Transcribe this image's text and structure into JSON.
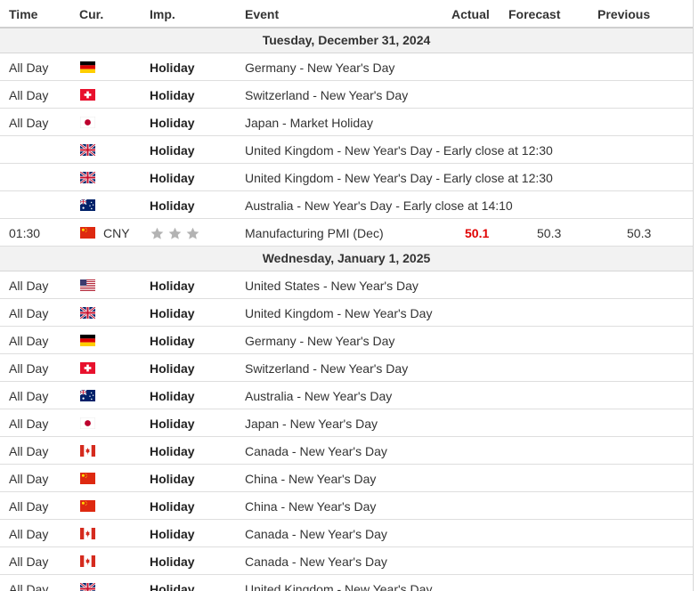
{
  "header": {
    "time": "Time",
    "currency": "Cur.",
    "importance": "Imp.",
    "event": "Event",
    "actual": "Actual",
    "forecast": "Forecast",
    "previous": "Previous"
  },
  "days": [
    {
      "date": "Tuesday, December 31, 2024",
      "rows": [
        {
          "time": "All Day",
          "flag": "de",
          "currency": "",
          "importance": "Holiday",
          "event": "Germany - New Year's Day",
          "actual": "",
          "forecast": "",
          "previous": ""
        },
        {
          "time": "All Day",
          "flag": "ch",
          "currency": "",
          "importance": "Holiday",
          "event": "Switzerland - New Year's Day",
          "actual": "",
          "forecast": "",
          "previous": ""
        },
        {
          "time": "All Day",
          "flag": "jp",
          "currency": "",
          "importance": "Holiday",
          "event": "Japan - Market Holiday",
          "actual": "",
          "forecast": "",
          "previous": ""
        },
        {
          "time": "",
          "flag": "gb",
          "currency": "",
          "importance": "Holiday",
          "event": "United Kingdom - New Year's Day - Early close at 12:30",
          "actual": "",
          "forecast": "",
          "previous": ""
        },
        {
          "time": "",
          "flag": "gb",
          "currency": "",
          "importance": "Holiday",
          "event": "United Kingdom - New Year's Day - Early close at 12:30",
          "actual": "",
          "forecast": "",
          "previous": ""
        },
        {
          "time": "",
          "flag": "au",
          "currency": "",
          "importance": "Holiday",
          "event": "Australia - New Year's Day - Early close at 14:10",
          "actual": "",
          "forecast": "",
          "previous": ""
        },
        {
          "time": "01:30",
          "flag": "cn",
          "currency": "CNY",
          "importance": "",
          "stars": 3,
          "event": "Manufacturing PMI (Dec)",
          "actual": "50.1",
          "forecast": "50.3",
          "previous": "50.3"
        }
      ]
    },
    {
      "date": "Wednesday, January 1, 2025",
      "rows": [
        {
          "time": "All Day",
          "flag": "us",
          "currency": "",
          "importance": "Holiday",
          "event": "United States - New Year's Day",
          "actual": "",
          "forecast": "",
          "previous": ""
        },
        {
          "time": "All Day",
          "flag": "gb",
          "currency": "",
          "importance": "Holiday",
          "event": "United Kingdom - New Year's Day",
          "actual": "",
          "forecast": "",
          "previous": ""
        },
        {
          "time": "All Day",
          "flag": "de",
          "currency": "",
          "importance": "Holiday",
          "event": "Germany - New Year's Day",
          "actual": "",
          "forecast": "",
          "previous": ""
        },
        {
          "time": "All Day",
          "flag": "ch",
          "currency": "",
          "importance": "Holiday",
          "event": "Switzerland - New Year's Day",
          "actual": "",
          "forecast": "",
          "previous": ""
        },
        {
          "time": "All Day",
          "flag": "au",
          "currency": "",
          "importance": "Holiday",
          "event": "Australia - New Year's Day",
          "actual": "",
          "forecast": "",
          "previous": ""
        },
        {
          "time": "All Day",
          "flag": "jp",
          "currency": "",
          "importance": "Holiday",
          "event": "Japan - New Year's Day",
          "actual": "",
          "forecast": "",
          "previous": ""
        },
        {
          "time": "All Day",
          "flag": "ca",
          "currency": "",
          "importance": "Holiday",
          "event": "Canada - New Year's Day",
          "actual": "",
          "forecast": "",
          "previous": ""
        },
        {
          "time": "All Day",
          "flag": "cn",
          "currency": "",
          "importance": "Holiday",
          "event": "China - New Year's Day",
          "actual": "",
          "forecast": "",
          "previous": ""
        },
        {
          "time": "All Day",
          "flag": "cn",
          "currency": "",
          "importance": "Holiday",
          "event": "China - New Year's Day",
          "actual": "",
          "forecast": "",
          "previous": ""
        },
        {
          "time": "All Day",
          "flag": "ca",
          "currency": "",
          "importance": "Holiday",
          "event": "Canada - New Year's Day",
          "actual": "",
          "forecast": "",
          "previous": ""
        },
        {
          "time": "All Day",
          "flag": "ca",
          "currency": "",
          "importance": "Holiday",
          "event": "Canada - New Year's Day",
          "actual": "",
          "forecast": "",
          "previous": ""
        },
        {
          "time": "All Day",
          "flag": "gb",
          "currency": "",
          "importance": "Holiday",
          "event": "United Kingdom - New Year's Day",
          "actual": "",
          "forecast": "",
          "previous": ""
        }
      ]
    }
  ],
  "colors": {
    "actual_red": "#e00000",
    "star_gray": "#b3b3b3",
    "day_bg": "#f2f2f2"
  }
}
